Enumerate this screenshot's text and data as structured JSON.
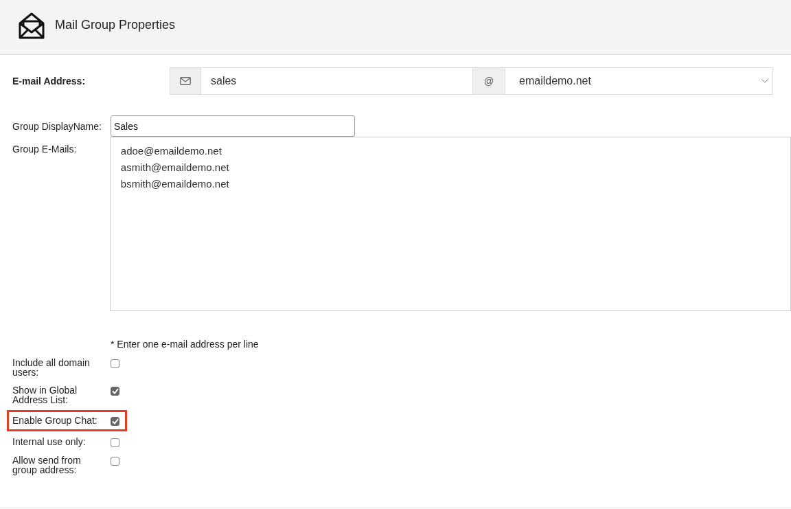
{
  "header": {
    "title": "Mail Group Properties"
  },
  "email_address": {
    "label": "E-mail Address:",
    "local_part": "sales",
    "at_sign": "@",
    "domain": "emaildemo.net"
  },
  "display_name": {
    "label": "Group DisplayName:",
    "value": "Sales"
  },
  "group_emails": {
    "label": "Group E-Mails:",
    "lines": [
      "adoe@emaildemo.net",
      "asmith@emaildemo.net",
      "bsmith@emaildemo.net"
    ],
    "note": "* Enter one e-mail address per line"
  },
  "options": [
    {
      "label": "Include all domain users:",
      "checked": false,
      "highlighted": false
    },
    {
      "label": "Show in Global Address List:",
      "checked": true,
      "highlighted": false
    },
    {
      "label": "Enable Group Chat:",
      "checked": true,
      "highlighted": true
    },
    {
      "label": "Internal use only:",
      "checked": false,
      "highlighted": false
    },
    {
      "label": "Allow send from group address:",
      "checked": false,
      "highlighted": false
    }
  ]
}
